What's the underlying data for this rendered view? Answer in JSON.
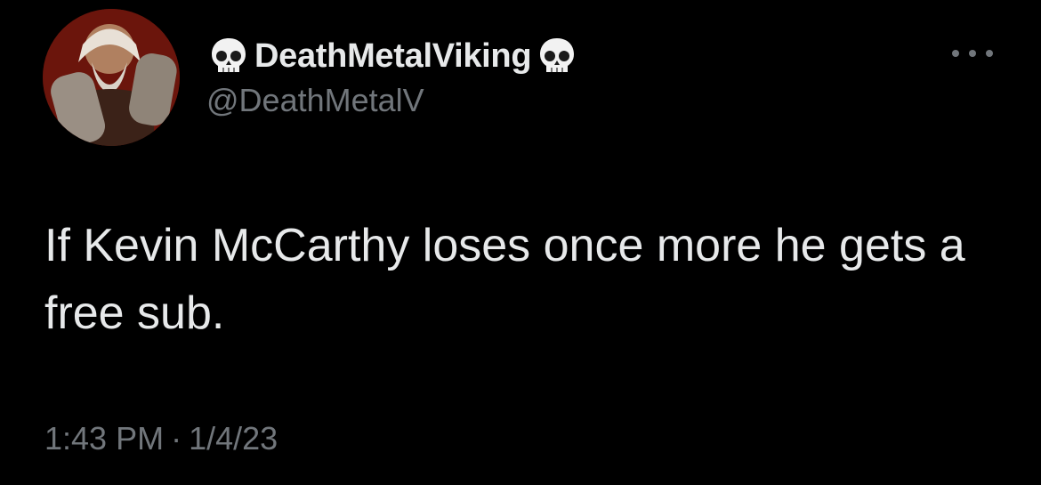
{
  "author": {
    "display_name": "DeathMetalViking",
    "handle": "@DeathMetalV",
    "name_emoji": "skull-emoji"
  },
  "tweet": {
    "text": "If Kevin McCarthy loses once more he gets a free sub.",
    "time": "1:43 PM",
    "separator": "·",
    "date": "1/4/23"
  },
  "colors": {
    "background": "#000000",
    "primary_text": "#e7e9ea",
    "secondary_text": "#71767b"
  },
  "icons": {
    "more": "more-horizontal-icon"
  }
}
